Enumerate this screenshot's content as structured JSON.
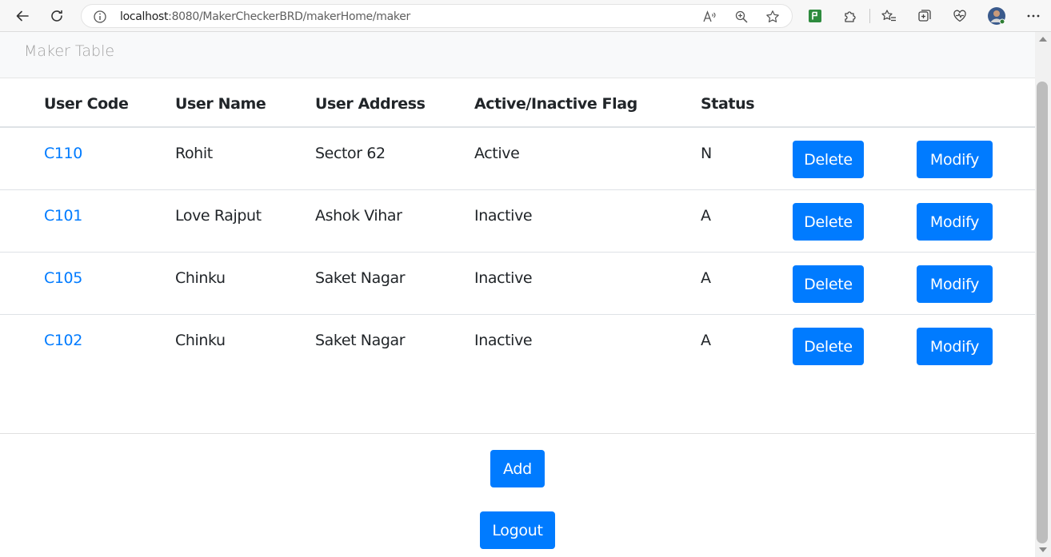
{
  "browser": {
    "url_host": "localhost",
    "url_rest": ":8080/MakerCheckerBRD/makerHome/maker"
  },
  "navbar": {
    "brand": "Maker Table"
  },
  "table": {
    "headers": [
      "User Code",
      "User Name",
      "User Address",
      "Active/Inactive Flag",
      "Status"
    ],
    "rows": [
      {
        "code": "C110",
        "name": "Rohit",
        "address": "Sector 62",
        "flag": "Active",
        "status": "N"
      },
      {
        "code": "C101",
        "name": "Love Rajput",
        "address": "Ashok Vihar",
        "flag": "Inactive",
        "status": "A"
      },
      {
        "code": "C105",
        "name": "Chinku",
        "address": "Saket Nagar",
        "flag": "Inactive",
        "status": "A"
      },
      {
        "code": "C102",
        "name": "Chinku",
        "address": "Saket Nagar",
        "flag": "Inactive",
        "status": "A"
      }
    ],
    "delete_label": "Delete",
    "modify_label": "Modify"
  },
  "actions": {
    "add_label": "Add",
    "logout_label": "Logout"
  },
  "colors": {
    "primary": "#007bff",
    "link": "#007bff",
    "text": "#212529",
    "navbar_bg": "#f8f9fa"
  }
}
